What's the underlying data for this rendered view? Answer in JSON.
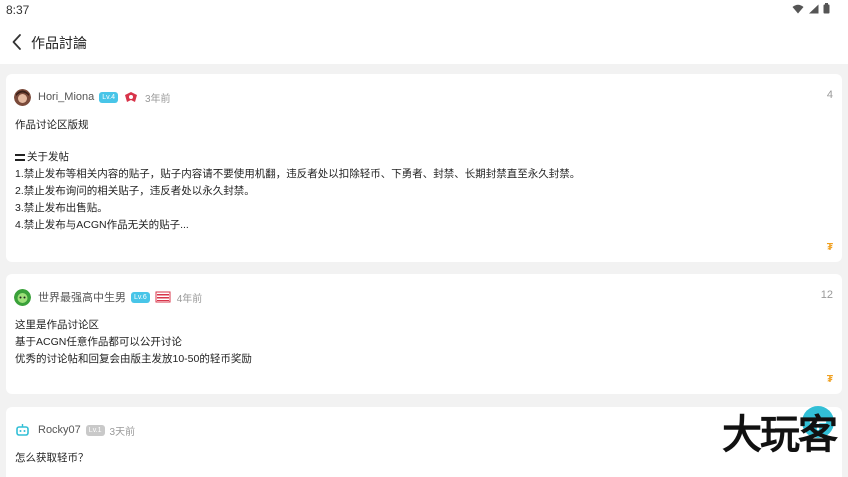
{
  "status_bar": {
    "time": "8:37",
    "icons": [
      "wifi-icon",
      "signal-icon",
      "battery-icon"
    ]
  },
  "app_bar": {
    "back_icon": "chevron-left-icon",
    "title": "作品討論"
  },
  "posts": [
    {
      "username": "Hori_Miona",
      "level_badge": "Lv.4",
      "medal": "red-badge-icon",
      "time": "3年前",
      "replies": "4",
      "lines": [
        "作品讨论区版规",
        "",
        "关于发帖",
        "1.禁止发布等相关内容的贴子，贴子内容请不要使用机翻，违反者处以扣除轻币、下勇者、封禁、长期封禁直至永久封禁。",
        "2.禁止发布询问的相关贴子，违反者处以永久封禁。",
        "3.禁止发布出售贴。",
        "4.禁止发布与ACGN作品无关的贴子..."
      ],
      "coin": "₮"
    },
    {
      "username": "世界最强高中生男",
      "level_badge": "Lv.6",
      "medal": "red-flag-icon",
      "time": "4年前",
      "replies": "12",
      "lines": [
        "这里是作品讨论区",
        "基于ACGN任意作品都可以公开讨论",
        "优秀的讨论帖和回复会由版主发放10-50的轻币奖励"
      ],
      "coin": "₮"
    },
    {
      "username": "Rocky07",
      "level_badge": "Lv.1",
      "time": "3天前",
      "lines": [
        "怎么获取轻币？"
      ]
    }
  ],
  "fab": {
    "icon": "plus-icon"
  },
  "watermark": {
    "text": "大玩客"
  },
  "colors": {
    "accent": "#32bfd6",
    "level_badge": "#48c5e8",
    "coin": "#f0a020",
    "background": "#f2f2f2"
  }
}
